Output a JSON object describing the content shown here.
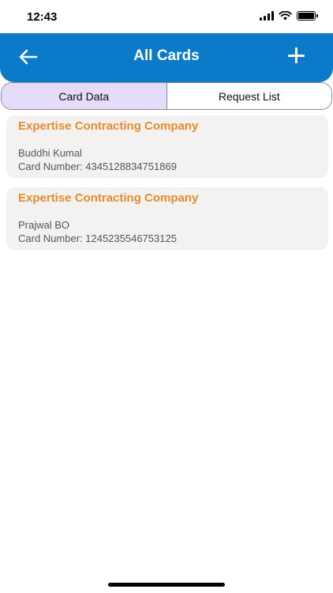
{
  "status": {
    "time": "12:43"
  },
  "header": {
    "title": "All Cards",
    "color": "#0a7ac9"
  },
  "tabs": [
    {
      "label": "Card Data",
      "active": true
    },
    {
      "label": "Request List",
      "active": false
    }
  ],
  "cards": [
    {
      "company": "Expertise Contracting Company",
      "holder": "Buddhi Kumal",
      "number": "Card Number: 4345128834751869"
    },
    {
      "company": "Expertise Contracting Company",
      "holder": "Prajwal BO",
      "number": "Card Number: 1245235546753125"
    }
  ],
  "icons": {
    "back": "arrow-left-icon",
    "add": "plus-icon",
    "signal": "cellular-signal-icon",
    "wifi": "wifi-icon",
    "battery": "battery-icon"
  },
  "colors": {
    "accent": "#e98b2c",
    "active_tab": "#e4dcf8",
    "card_bg": "#f3f2f1"
  }
}
